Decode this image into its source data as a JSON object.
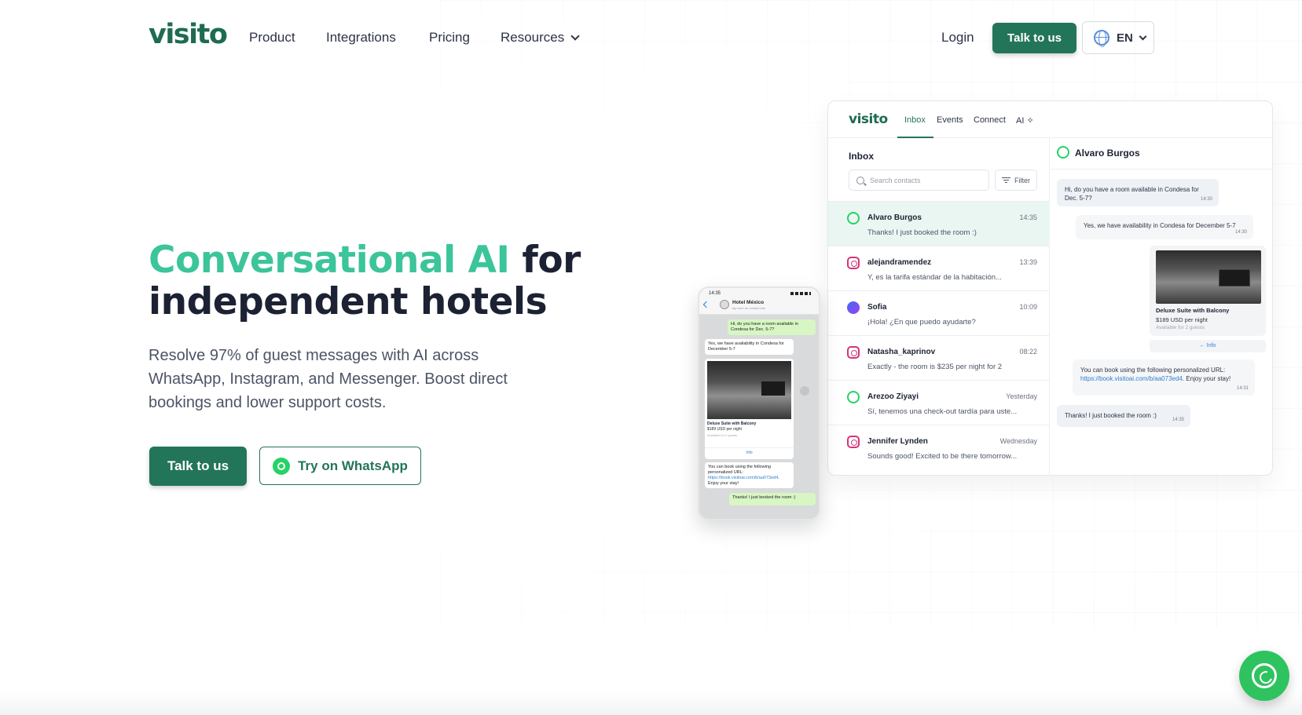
{
  "nav": {
    "logo": "visito",
    "links": [
      "Product",
      "Integrations",
      "Pricing",
      "Resources"
    ],
    "login": "Login",
    "cta": "Talk to us",
    "language": "EN"
  },
  "hero": {
    "title_accent": "Conversational AI",
    "title_rest_1": " for",
    "title_rest_2": "independent hotels",
    "subtitle": "Resolve 97% of guest messages with AI across WhatsApp, Instagram, and Messenger. Boost direct bookings and lower support costs.",
    "cta_primary": "Talk to us",
    "cta_secondary": "Try on WhatsApp"
  },
  "app": {
    "logo": "visito",
    "tabs": [
      "Inbox",
      "Events",
      "Connect",
      "AI"
    ],
    "inbox_title": "Inbox",
    "search_placeholder": "Search contacts",
    "filter_label": "Filter",
    "conversations": [
      {
        "channel": "whatsapp-icon",
        "name": "Alvaro Burgos",
        "time": "14:35",
        "message": "Thanks! I just booked the room :)"
      },
      {
        "channel": "instagram-icon",
        "name": "alejandramendez",
        "time": "13:39",
        "message": "Y, es la tarifa estándar de la habitación..."
      },
      {
        "channel": "messenger-icon",
        "name": "Sofia",
        "time": "10:09",
        "message": "¡Hola! ¿En que puedo ayudarte?"
      },
      {
        "channel": "instagram-icon",
        "name": "Natasha_kaprinov",
        "time": "08:22",
        "message": "Exactly - the room is $235 per night for 2"
      },
      {
        "channel": "whatsapp-icon",
        "name": "Arezoo Ziyayi",
        "time": "Yesterday",
        "message": "Sí, tenemos una check-out tardía para uste..."
      },
      {
        "channel": "instagram-icon",
        "name": "Jennifer Lynden",
        "time": "Wednesday",
        "message": "Sounds good! Excited to be there tomorrow..."
      }
    ],
    "chat": {
      "contact": "Alvaro Burgos",
      "msg1": "Hi, do you have a room available in Condesa for Dec. 5-7?",
      "msg1_time": "14:30",
      "msg2": "Yes, we have availability in Condesa for December 5-7",
      "msg2_time": "14:30",
      "room_title": "Deluxe Suite with Balcony",
      "room_price": "$189 USD per night",
      "room_avail": "Available for 2 guests",
      "info": "Info",
      "msg3": "You can book using the following personalized URL:",
      "msg3_link": "https://book.visitoai.com/b/aa073ed4",
      "msg3_end": ". Enjoy your stay!",
      "msg3_time": "14:31",
      "msg4": "Thanks! I just booked the room :)",
      "msg4_time": "14:35"
    }
  },
  "phone": {
    "time": "14:35",
    "hotel": "Hotel México",
    "hotel_sub": "tap here for contact info",
    "msg1": "Hi, do you have a room available in Condesa for Dec. 5-7?",
    "msg1_time": "14:30",
    "msg2": "Yes, we have availability in Condesa for December 5-7",
    "msg2_time": "14:30",
    "room_title": "Deluxe Suite with Balcony",
    "room_price": "$189 USD per night",
    "room_avail": "Available for 2 guests",
    "info": "Info",
    "msg3": "You can book using the following personalized URL:",
    "msg3_link": "https://book.visitoai.com/b/aa073ed4",
    "msg3_end": ". Enjoy your stay!",
    "msg3_time": "14:31",
    "msg4": "Thanks! I just booked the room :)",
    "msg4_time": "14:35"
  },
  "colors": {
    "brand": "#23755a",
    "accent": "#3cc49a",
    "whatsapp": "#25d366"
  }
}
